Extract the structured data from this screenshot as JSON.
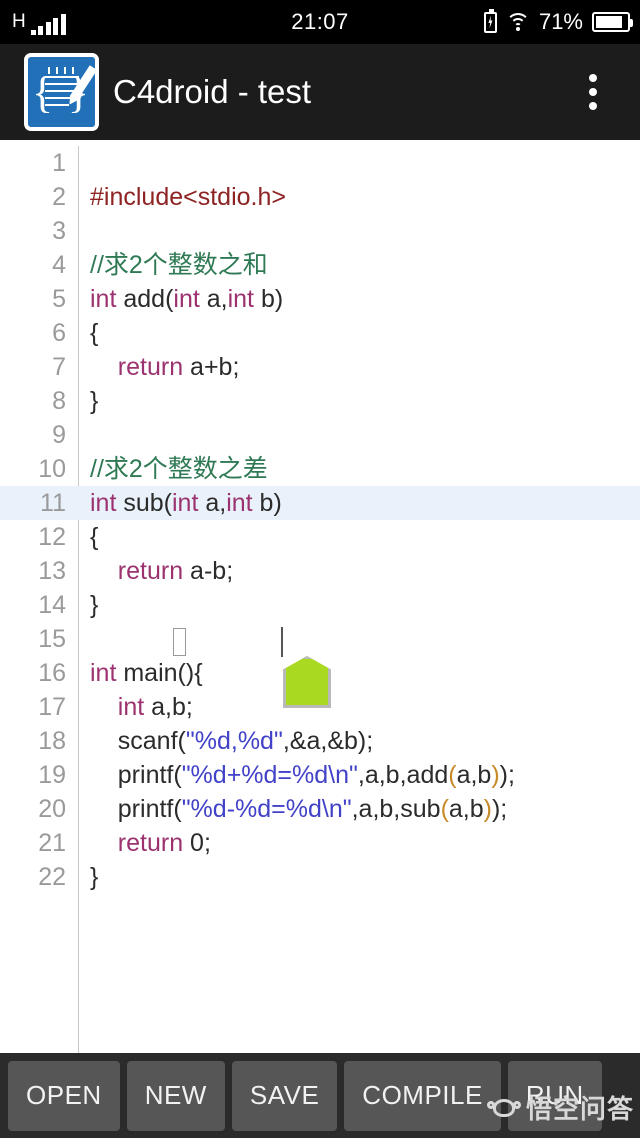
{
  "status_bar": {
    "network_type": "H",
    "signal_bars": 5,
    "time": "21:07",
    "battery_percent": "71%",
    "charging": true,
    "wifi_icon": "wifi-icon",
    "battery_icon": "battery-icon"
  },
  "title_bar": {
    "app_icon": "c4droid-app-icon",
    "title": "C4droid - test",
    "overflow_icon": "overflow-menu-icon"
  },
  "editor": {
    "selected_line": 11,
    "cursor_line": 11,
    "colors": {
      "keyword": "#9c3370",
      "preprocessor": "#8d2323",
      "comment": "#2f7a55",
      "string": "#4242c8",
      "paren_match": "#c98a28",
      "plain": "#2b2b2b",
      "line_number": "#9a9a9a",
      "selection_bg": "#e9f2fb",
      "handle": "#aad922"
    },
    "lines": [
      {
        "n": "1",
        "tokens": []
      },
      {
        "n": "2",
        "tokens": [
          {
            "t": "#include<stdio.h>",
            "c": "pre"
          }
        ]
      },
      {
        "n": "3",
        "tokens": []
      },
      {
        "n": "4",
        "tokens": [
          {
            "t": "//求2个整数之和",
            "c": "cmt"
          }
        ]
      },
      {
        "n": "5",
        "tokens": [
          {
            "t": "int",
            "c": "kw"
          },
          {
            "t": " add(",
            "c": "plain"
          },
          {
            "t": "int",
            "c": "kw"
          },
          {
            "t": " a,",
            "c": "plain"
          },
          {
            "t": "int",
            "c": "kw"
          },
          {
            "t": " b)",
            "c": "plain"
          }
        ]
      },
      {
        "n": "6",
        "tokens": [
          {
            "t": "{",
            "c": "plain"
          }
        ]
      },
      {
        "n": "7",
        "tokens": [
          {
            "t": "    ",
            "c": "plain"
          },
          {
            "t": "return",
            "c": "kw"
          },
          {
            "t": " a+b;",
            "c": "plain"
          }
        ]
      },
      {
        "n": "8",
        "tokens": [
          {
            "t": "}",
            "c": "plain"
          }
        ]
      },
      {
        "n": "9",
        "tokens": []
      },
      {
        "n": "10",
        "tokens": [
          {
            "t": "//求2个整数之差",
            "c": "cmt"
          }
        ]
      },
      {
        "n": "11",
        "tokens": [
          {
            "t": "int",
            "c": "kw"
          },
          {
            "t": " sub(",
            "c": "plain"
          },
          {
            "t": "int",
            "c": "kw"
          },
          {
            "t": " a,",
            "c": "plain"
          },
          {
            "t": "int",
            "c": "kw"
          },
          {
            "t": " b)",
            "c": "plain"
          }
        ],
        "selected": true
      },
      {
        "n": "12",
        "tokens": [
          {
            "t": "{",
            "c": "plain"
          }
        ]
      },
      {
        "n": "13",
        "tokens": [
          {
            "t": "    ",
            "c": "plain"
          },
          {
            "t": "return",
            "c": "kw"
          },
          {
            "t": " a-b;",
            "c": "plain"
          }
        ]
      },
      {
        "n": "14",
        "tokens": [
          {
            "t": "}",
            "c": "plain"
          }
        ]
      },
      {
        "n": "15",
        "tokens": []
      },
      {
        "n": "16",
        "tokens": [
          {
            "t": "int",
            "c": "kw"
          },
          {
            "t": " main(){",
            "c": "plain"
          }
        ]
      },
      {
        "n": "17",
        "tokens": [
          {
            "t": "    ",
            "c": "plain"
          },
          {
            "t": "int",
            "c": "kw"
          },
          {
            "t": " a,b;",
            "c": "plain"
          }
        ]
      },
      {
        "n": "18",
        "tokens": [
          {
            "t": "    scanf(",
            "c": "plain"
          },
          {
            "t": "\"%d,%d\"",
            "c": "str"
          },
          {
            "t": ",&a,&b);",
            "c": "plain"
          }
        ]
      },
      {
        "n": "19",
        "tokens": [
          {
            "t": "    printf(",
            "c": "plain"
          },
          {
            "t": "\"%d+%d=%d\\n\"",
            "c": "str"
          },
          {
            "t": ",a,b,add",
            "c": "plain"
          },
          {
            "t": "(",
            "c": "paren"
          },
          {
            "t": "a,b",
            "c": "plain"
          },
          {
            "t": ")",
            "c": "paren"
          },
          {
            "t": ");",
            "c": "plain"
          }
        ]
      },
      {
        "n": "20",
        "tokens": [
          {
            "t": "    printf(",
            "c": "plain"
          },
          {
            "t": "\"%d-%d=%d\\n\"",
            "c": "str"
          },
          {
            "t": ",a,b,sub",
            "c": "plain"
          },
          {
            "t": "(",
            "c": "paren"
          },
          {
            "t": "a,b",
            "c": "plain"
          },
          {
            "t": ")",
            "c": "paren"
          },
          {
            "t": ");",
            "c": "plain"
          }
        ]
      },
      {
        "n": "21",
        "tokens": [
          {
            "t": "    ",
            "c": "plain"
          },
          {
            "t": "return",
            "c": "kw"
          },
          {
            "t": " 0;",
            "c": "plain"
          }
        ]
      },
      {
        "n": "22",
        "tokens": [
          {
            "t": "}",
            "c": "plain"
          }
        ]
      }
    ]
  },
  "toolbar": {
    "buttons": [
      {
        "label": "OPEN",
        "name": "open-button"
      },
      {
        "label": "NEW",
        "name": "new-button"
      },
      {
        "label": "SAVE",
        "name": "save-button"
      },
      {
        "label": "COMPILE",
        "name": "compile-button"
      },
      {
        "label": "RUN",
        "name": "run-button"
      }
    ]
  },
  "watermark": {
    "text": "悟空问答",
    "logo": "wukong-logo"
  }
}
